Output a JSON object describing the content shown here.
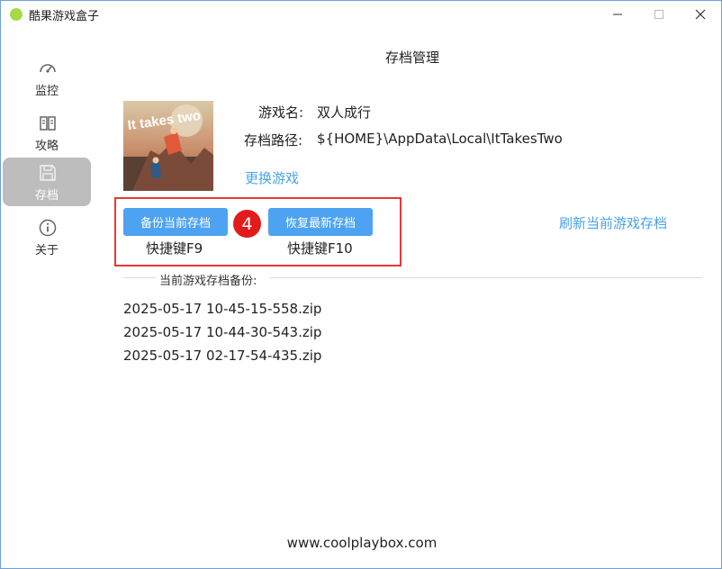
{
  "window": {
    "title": "酷果游戏盒子"
  },
  "sidebar": {
    "items": [
      {
        "label": "监控",
        "icon": "gauge-icon",
        "active": false
      },
      {
        "label": "攻略",
        "icon": "book-icon",
        "active": false
      },
      {
        "label": "存档",
        "icon": "save-icon",
        "active": true
      },
      {
        "label": "关于",
        "icon": "info-icon",
        "active": false
      }
    ]
  },
  "main": {
    "page_title": "存档管理",
    "cover_text": "It takes two",
    "game_name_label": "游戏名:",
    "game_name": "双人成行",
    "save_path_label": "存档路径:",
    "save_path": "${HOME}\\AppData\\Local\\ItTakesTwo",
    "change_game_link": "更换游戏",
    "backup_button": "备份当前存档",
    "backup_hotkey": "快捷键F9",
    "restore_button": "恢复最新存档",
    "restore_hotkey": "快捷键F10",
    "annotation_badge": "4",
    "refresh_link": "刷新当前游戏存档",
    "backups_label": "当前游戏存档备份:",
    "backup_files": [
      "2025-05-17 10-45-15-558.zip",
      "2025-05-17 10-44-30-543.zip",
      "2025-05-17 02-17-54-435.zip"
    ]
  },
  "footer": {
    "website": "www.coolplaybox.com"
  },
  "colors": {
    "accent": "#4da3f2",
    "link": "#4aa3e8",
    "highlight": "#e53935",
    "badge": "#e31b1b",
    "sidebar_active": "#bdbdbd"
  }
}
